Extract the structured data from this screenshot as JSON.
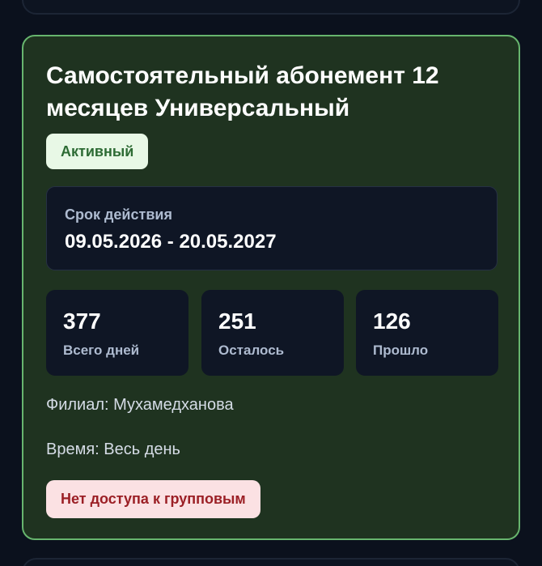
{
  "subscription": {
    "title": "Самостоятельный абонемент 12 месяцев Универсальный",
    "status": "Активный",
    "validity": {
      "label": "Срок действия",
      "value": "09.05.2026 - 20.05.2027"
    },
    "stats": [
      {
        "value": "377",
        "label": "Всего дней"
      },
      {
        "value": "251",
        "label": "Осталось"
      },
      {
        "value": "126",
        "label": "Прошло"
      }
    ],
    "branch": "Филиал: Мухамедханова",
    "time": "Время: Весь день",
    "group_access": "Нет доступа к групповым"
  },
  "colors": {
    "background": "#0b111d",
    "card": "#1f3320",
    "card_border": "#67b56e",
    "panel": "#0f1625",
    "active_badge": "#e8f8e6",
    "active_text": "#2d6b34",
    "warning_badge": "#fbe1e3",
    "warning_text": "#9b1f25"
  }
}
